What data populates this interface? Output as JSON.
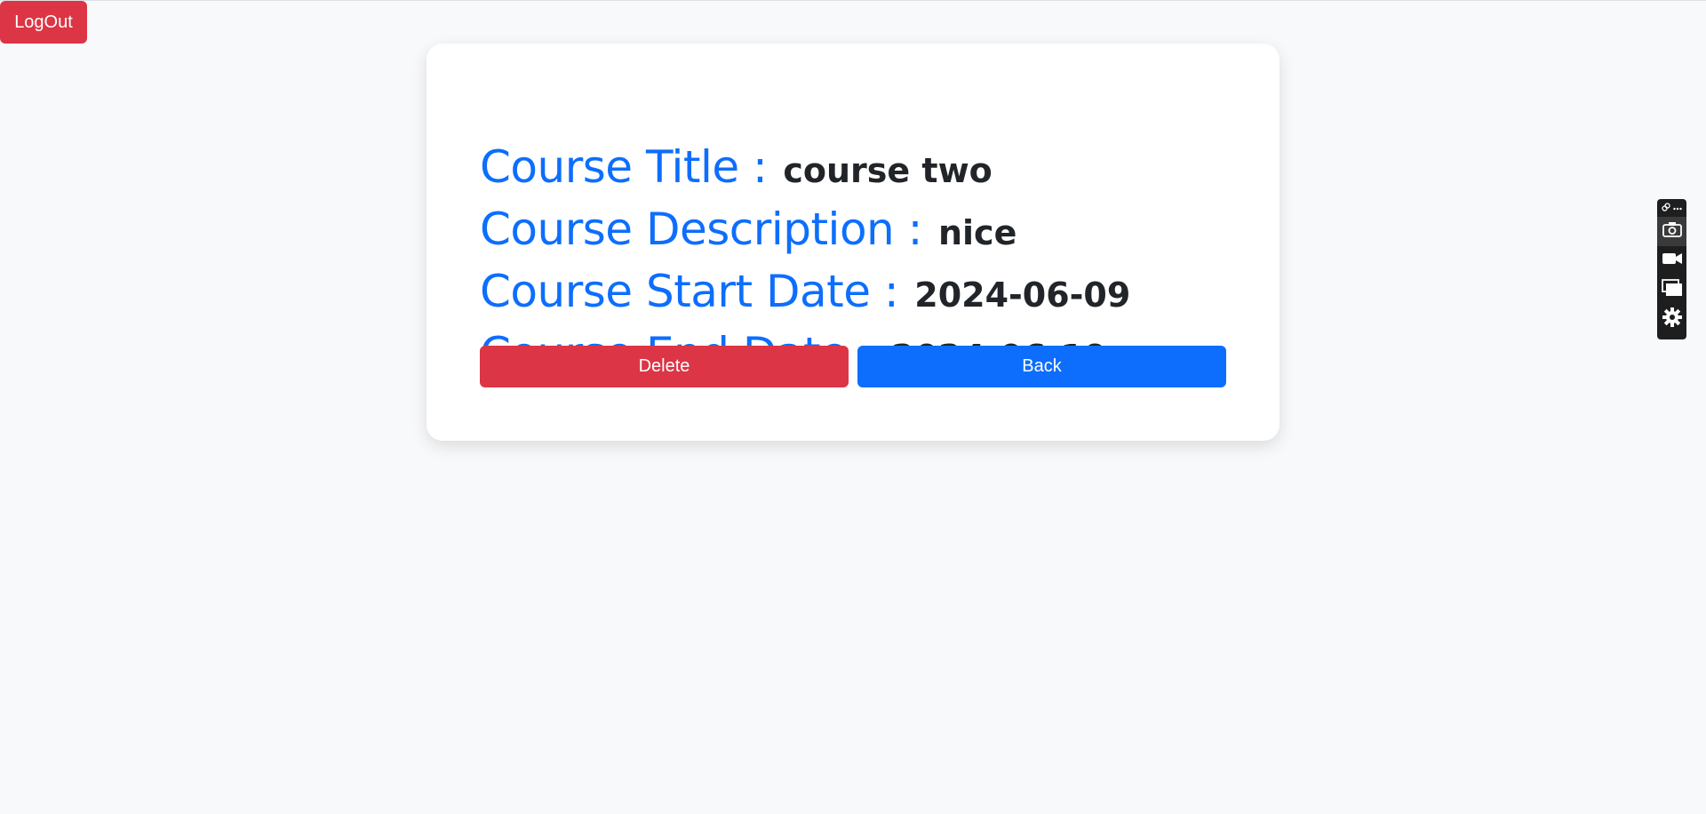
{
  "header": {
    "logout_label": "LogOut"
  },
  "course": {
    "title_label": "Course Title :",
    "title_value": "course two",
    "description_label": "Course Description :",
    "description_value": "nice",
    "start_label": "Course Start Date :",
    "start_value": "2024-06-09",
    "end_label": "Course End Date :",
    "end_value": "2024-06-19"
  },
  "actions": {
    "delete_label": "Delete",
    "back_label": "Back"
  },
  "toolbar": {
    "icons": [
      "link-icon",
      "more-icon",
      "camera-icon",
      "video-icon",
      "windows-icon",
      "gear-icon"
    ]
  },
  "colors": {
    "primary": "#0d6efd",
    "danger": "#dc3545",
    "background": "#f8f9fa",
    "text": "#212529"
  }
}
